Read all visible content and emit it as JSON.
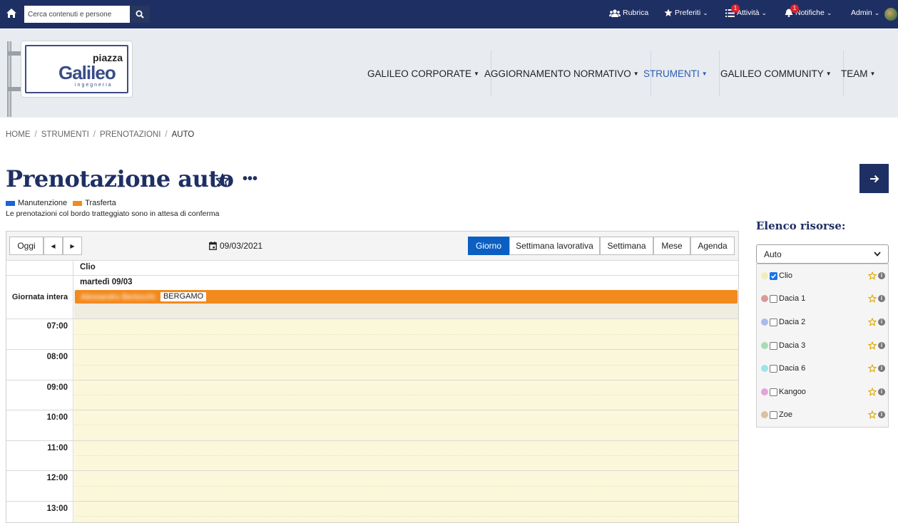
{
  "topbar": {
    "search_placeholder": "Cerca contenuti e persone",
    "rubrica": "Rubrica",
    "preferiti": "Preferiti",
    "attivita": "Attività",
    "attivita_badge": "1",
    "notifiche": "Notifiche",
    "notifiche_badge": "1",
    "admin": "Admin"
  },
  "logo": {
    "top": "piazza",
    "main": "Galileo",
    "sub": "ingegneria"
  },
  "nav": {
    "items": [
      {
        "label": "GALILEO CORPORATE"
      },
      {
        "label": "AGGIORNAMENTO NORMATIVO"
      },
      {
        "label": "STRUMENTI"
      },
      {
        "label": "GALILEO COMMUNITY"
      },
      {
        "label": "TEAM"
      }
    ]
  },
  "breadcrumb": [
    "HOME",
    "STRUMENTI",
    "PRENOTAZIONI",
    "AUTO"
  ],
  "page": {
    "title": "Prenotazione auto",
    "legend": [
      {
        "label": "Manutenzione",
        "color": "#1a63d8"
      },
      {
        "label": "Trasferta",
        "color": "#f28a1e"
      }
    ],
    "note": "Le prenotazioni col bordo tratteggiato sono in attesa di conferma"
  },
  "calendar": {
    "today_label": "Oggi",
    "date": "09/03/2021",
    "views": [
      "Giorno",
      "Settimana lavorativa",
      "Settimana",
      "Mese",
      "Agenda"
    ],
    "active_view": "Giorno",
    "resource": "Clio",
    "day_header": "martedì 09/03",
    "allday_label": "Giornata intera",
    "event": {
      "name": "Alessandro Bertocchi",
      "place": "BERGAMO"
    },
    "hours": [
      "07:00",
      "08:00",
      "09:00",
      "10:00",
      "11:00",
      "12:00",
      "13:00"
    ]
  },
  "resources": {
    "title": "Elenco risorse:",
    "select_value": "Auto",
    "items": [
      {
        "name": "Clio",
        "checked": true,
        "color": "#f2ecb8"
      },
      {
        "name": "Dacia 1",
        "checked": false,
        "color": "#d99a9a"
      },
      {
        "name": "Dacia 2",
        "checked": false,
        "color": "#a9bcea"
      },
      {
        "name": "Dacia 3",
        "checked": false,
        "color": "#a9dcb4"
      },
      {
        "name": "Dacia 6",
        "checked": false,
        "color": "#9fe3e6"
      },
      {
        "name": "Kangoo",
        "checked": false,
        "color": "#e3a3dc"
      },
      {
        "name": "Zoe",
        "checked": false,
        "color": "#dcc0a2"
      }
    ]
  }
}
